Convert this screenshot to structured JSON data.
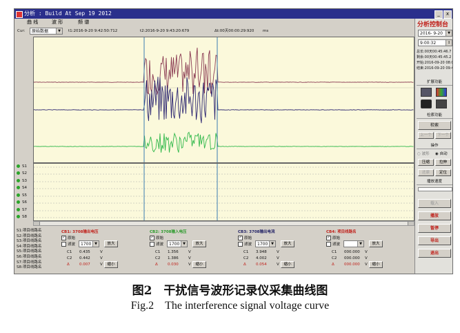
{
  "window": {
    "title": "分析 : Build At Sep 19 2012",
    "min_label": "_",
    "close_label": "x"
  },
  "menu": [
    {
      "label": "曲 线"
    },
    {
      "label": "波 形"
    },
    {
      "label": "频 谱"
    }
  ],
  "toolbar": {
    "cur_label": "Cur:",
    "cur_value": "原始数据",
    "t1": "t1:2016-9-20 9:42:50:712",
    "t2": "t2:2016-9-20 9:43:20:679",
    "dt": "Δt:00天00:00:29:920",
    "dt_unit": "ms"
  },
  "channels": [
    "S1",
    "S2",
    "S3",
    "S4",
    "S5",
    "S6",
    "S7",
    "S8"
  ],
  "slot_list": [
    "S1:项目线路名",
    "S2:项目线路名",
    "S3:项目线路名",
    "S4:项目线路名",
    "S5:项目线路名",
    "S6:项目线路名",
    "S7:项目线路名",
    "S8:项目线路名"
  ],
  "cb_panels": [
    {
      "title": "CB1: 3708输出电压",
      "color": "#c0201a",
      "raw": "原始",
      "filter": "滤波",
      "sel": "1700",
      "btn_zoom_in": "放大",
      "btn_zoom_out": "缩小",
      "c1_label": "C1",
      "c1_val": "0.435",
      "c2_label": "C2",
      "c2_val": "0.442",
      "d_label": "Δ",
      "d_val": "0.007",
      "unit": "V"
    },
    {
      "title": "CB2: 3708输入电压",
      "color": "#2a9a2a",
      "raw": "原始",
      "filter": "滤波",
      "sel": "1700",
      "btn_zoom_in": "放大",
      "btn_zoom_out": "缩小",
      "c1_label": "C1",
      "c1_val": "1.356",
      "c2_label": "C2",
      "c2_val": "1.386",
      "d_label": "Δ",
      "d_val": "0.030",
      "unit": "V"
    },
    {
      "title": "CB3: 3708输出电流",
      "color": "#222266",
      "raw": "原始",
      "filter": "滤波",
      "sel": "1700",
      "btn_zoom_in": "放大",
      "btn_zoom_out": "缩小",
      "c1_label": "C1",
      "c1_val": "3.948",
      "c2_label": "C2",
      "c2_val": "4.002",
      "d_label": "Δ",
      "d_val": "0.054",
      "unit": "V"
    },
    {
      "title": "CB4: 项目线路名",
      "color": "#c0201a",
      "raw": "原始",
      "filter": "滤波",
      "sel": "",
      "btn_zoom_in": "放大",
      "btn_zoom_out": "缩小",
      "c1_label": "C1",
      "c1_val": "000.000",
      "c2_label": "C2",
      "c2_val": "000.000",
      "d_label": "Δ",
      "d_val": "000.000",
      "unit": "V"
    }
  ],
  "right_panel": {
    "title": "分析控制台",
    "date": "2016- 9-20",
    "time": "9:00:32",
    "info": [
      "总长:00天00:45:46.7",
      "剩余:00天00:45:45.2",
      "开始:2016-09-20 08:0",
      "结束:2016-09-20 09:4"
    ],
    "ext_section": "扩展功能",
    "search_section": "检索功能",
    "search_btn": "检索",
    "prev_btn": "上一个",
    "next_btn": "下一个",
    "op_section": "操作",
    "radio_wave": "波形",
    "radio_auto": "自动",
    "btn_zoom": "压缩",
    "btn_stretch": "拉伸",
    "btn_restore": "还原",
    "btn_locate": "定位",
    "speed_section": "播放速度",
    "btn_load": "载入",
    "btn_play": "播放",
    "btn_pause": "暂停",
    "btn_export": "导出",
    "btn_exit": "退出"
  },
  "caption": {
    "cn": "图2　干扰信号波形记录仪采集曲线图",
    "en": "Fig.2　The interference signal voltage curve"
  },
  "colors": {
    "red_trace": "#8a3a52",
    "navy_trace": "#2a2470",
    "green_trace": "#2fb84a",
    "cursor": "#3a7ab0",
    "plot_bg": "#fbf9db"
  }
}
